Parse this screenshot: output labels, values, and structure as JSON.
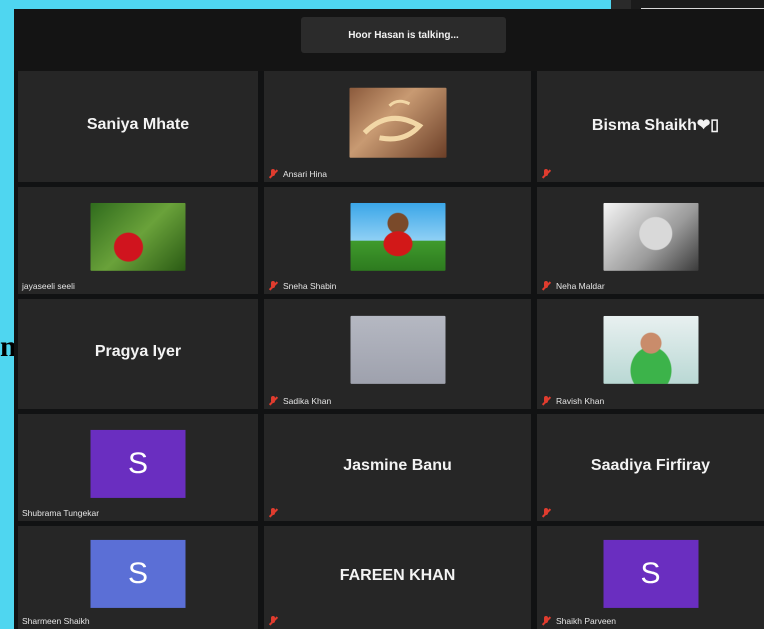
{
  "banner": {
    "talking": "Hoor Hasan is talking..."
  },
  "left_fragment": "n,",
  "participants": [
    {
      "display": "Saniya Mhate",
      "footer": "",
      "muted": false
    },
    {
      "display": "",
      "footer": "Ansari Hina",
      "muted": true,
      "photo": "calligraphy"
    },
    {
      "display": "Bisma  Shaikh❤▯",
      "footer": "",
      "muted": true
    },
    {
      "display": "",
      "footer": "jayaseeli seeli",
      "muted": false,
      "photo": "flower"
    },
    {
      "display": "",
      "footer": "Sneha Shabin",
      "muted": true,
      "photo": "boy"
    },
    {
      "display": "",
      "footer": "Neha Maldar",
      "muted": true,
      "photo": "bw-portrait"
    },
    {
      "display": "Pragya Iyer",
      "footer": "",
      "muted": false
    },
    {
      "display": "",
      "footer": "Sadika Khan",
      "muted": true,
      "photo": "gray"
    },
    {
      "display": "",
      "footer": "Ravish Khan",
      "muted": true,
      "photo": "woman"
    },
    {
      "display": "",
      "footer": "Shubrama Tungekar",
      "muted": false,
      "avatar": "S",
      "avatar_color": "#6a2ec0"
    },
    {
      "display": "Jasmine Banu",
      "footer": "",
      "muted": true
    },
    {
      "display": "Saadiya Firfiray",
      "footer": "",
      "muted": true
    },
    {
      "display": "",
      "footer": "Sharmeen Shaikh",
      "muted": false,
      "avatar": "S",
      "avatar_color": "#5b6fd6"
    },
    {
      "display": "FAREEN KHAN",
      "footer": "",
      "muted": true
    },
    {
      "display": "",
      "footer": "Shaikh Parveen",
      "muted": true,
      "avatar": "S",
      "avatar_color": "#6a2ec0"
    }
  ]
}
